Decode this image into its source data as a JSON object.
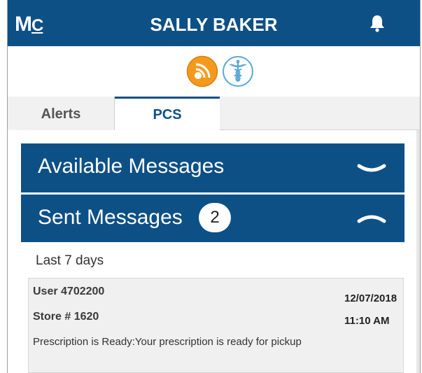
{
  "header": {
    "logo": "M",
    "logo_suffix": "C",
    "user_name": "SALLY BAKER",
    "bell_icon": "bell-icon",
    "background": "#0d5086"
  },
  "apps": [
    {
      "icon": "rx-signal-app-icon",
      "color": "#f39a1e"
    },
    {
      "icon": "caduceus-app-icon",
      "color": "#5aa9d6"
    }
  ],
  "tabs": [
    {
      "label": "Alerts",
      "active": false
    },
    {
      "label": "PCS",
      "active": true
    }
  ],
  "panels": {
    "available": {
      "title": "Available Messages",
      "state": "collapsed",
      "icon": "chevron-down-icon"
    },
    "sent": {
      "title": "Sent Messages",
      "count": "2",
      "state": "expanded",
      "icon": "chevron-up-icon"
    }
  },
  "range_label": "Last 7 days",
  "messages": [
    {
      "user": "User 4702200",
      "store": "Store # 1620",
      "date": "12/07/2018",
      "time": "11:10 AM",
      "body": "Prescription is Ready:Your prescription is ready for pickup"
    }
  ]
}
